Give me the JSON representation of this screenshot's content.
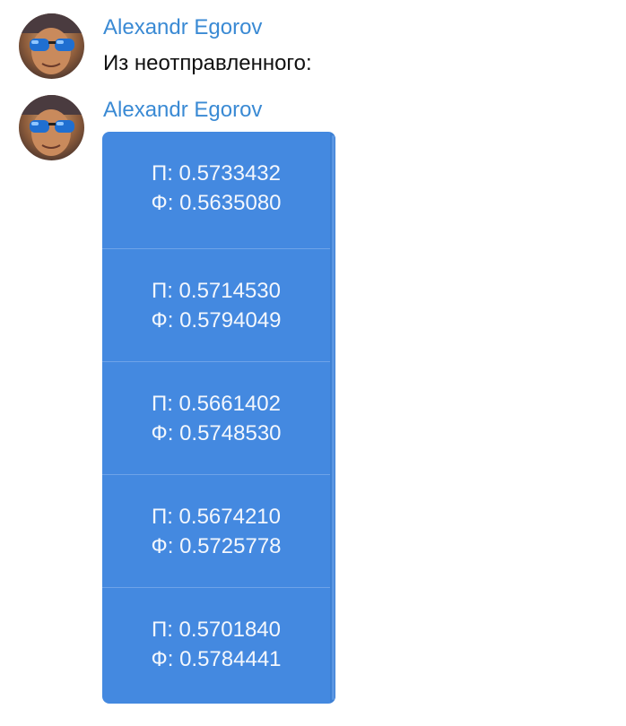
{
  "messages": [
    {
      "author": "Alexandr Egorov",
      "text": "Из неотправленного:"
    },
    {
      "author": "Alexandr Egorov",
      "buttons": [
        {
          "line1": "П: 0.5733432",
          "line2": "Ф: 0.5635080"
        },
        {
          "line1": "П: 0.5714530",
          "line2": "Ф: 0.5794049"
        },
        {
          "line1": "П: 0.5661402",
          "line2": "Ф: 0.5748530"
        },
        {
          "line1": "П: 0.5674210",
          "line2": "Ф: 0.5725778"
        },
        {
          "line1": "П: 0.5701840",
          "line2": "Ф: 0.5784441"
        }
      ]
    }
  ],
  "colors": {
    "author": "#3a8ad4",
    "button_bg": "#4489e0",
    "button_text": "#f3f7fd"
  },
  "icons": {
    "avatar": "user-photo-avatar"
  }
}
